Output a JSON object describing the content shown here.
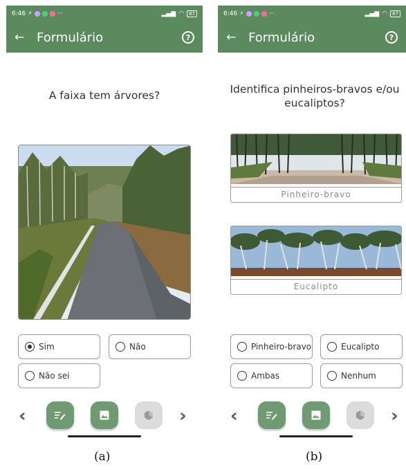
{
  "status_bar": {
    "time": "6:46",
    "battery": "87"
  },
  "app_bar": {
    "title": "Formulário",
    "help_glyph": "?"
  },
  "icons": [
    "arrow-left-icon",
    "help-circle-icon",
    "chevron-left-icon",
    "chevron-right-icon",
    "edit-form-icon",
    "image-icon",
    "hexagon-icon"
  ],
  "colors": {
    "primary": "#5b8a5f",
    "button": "#6f9a72",
    "disabled": "#dcdcdc"
  },
  "screen_a": {
    "question": "A faixa tem árvores?",
    "options": [
      {
        "label": "Sim",
        "selected": true
      },
      {
        "label": "Não",
        "selected": false
      },
      {
        "label": "Não sei",
        "selected": false
      }
    ]
  },
  "screen_b": {
    "question": "Identifica pinheiros-bravos e/ou eucaliptos?",
    "references": [
      {
        "caption": "Pinheiro-bravo"
      },
      {
        "caption": "Eucalipto"
      }
    ],
    "options": [
      {
        "label": "Pinheiro-bravo",
        "selected": false
      },
      {
        "label": "Eucalipto",
        "selected": false
      },
      {
        "label": "Ambas",
        "selected": false
      },
      {
        "label": "Nenhum",
        "selected": false
      }
    ]
  },
  "sublabels": {
    "a": "(a)",
    "b": "(b)"
  }
}
